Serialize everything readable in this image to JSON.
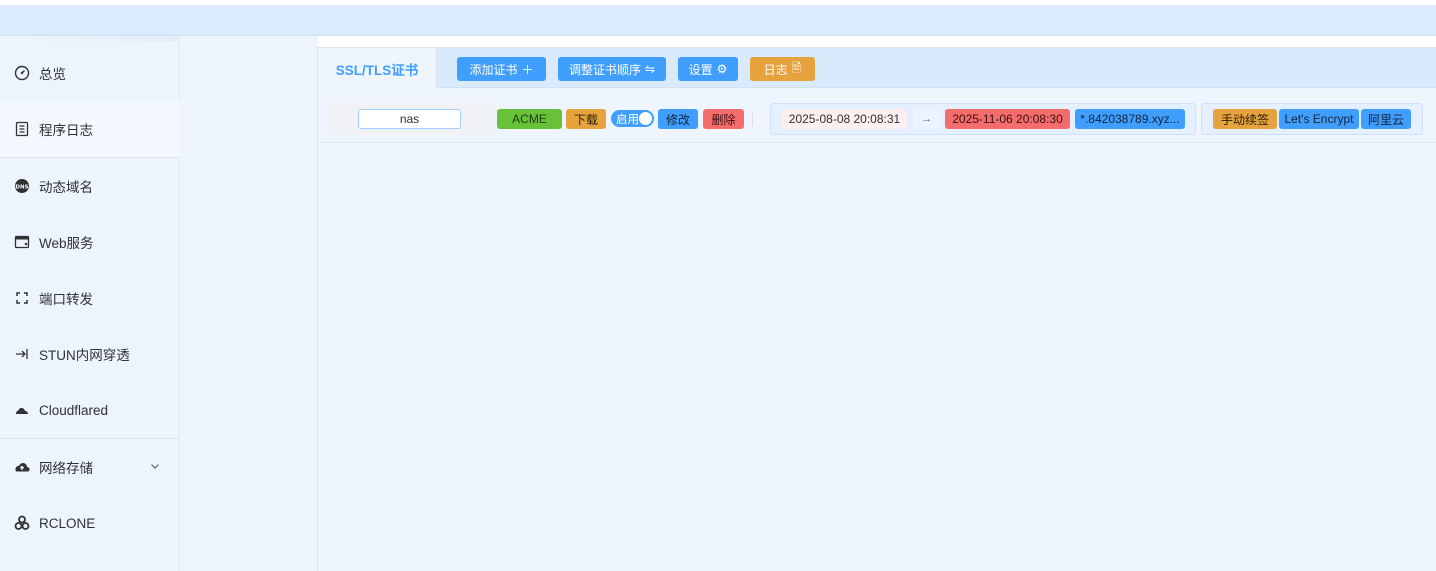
{
  "sidebar": {
    "items": [
      {
        "label": "总览",
        "icon": "dashboard-icon"
      },
      {
        "label": "程序日志",
        "icon": "log-icon"
      },
      {
        "label": "动态域名",
        "icon": "dns-icon"
      },
      {
        "label": "Web服务",
        "icon": "web-icon"
      },
      {
        "label": "端口转发",
        "icon": "port-forward-icon"
      },
      {
        "label": "STUN内网穿透",
        "icon": "stun-icon"
      },
      {
        "label": "Cloudflared",
        "icon": "cloud-icon"
      },
      {
        "label": "网络存储",
        "icon": "cloud-upload-icon"
      },
      {
        "label": "RCLONE",
        "icon": "rclone-icon"
      }
    ]
  },
  "tabs": {
    "active_label": "SSL/TLS证书"
  },
  "toolbar": {
    "add_label": "添加证书",
    "add_suffix": "＋",
    "reorder_label": "调整证书顺序",
    "reorder_suffix": "⇋",
    "settings_label": "设置",
    "settings_suffix": "⚙",
    "log_label": "日志",
    "log_suffix": "🗎"
  },
  "cert_row": {
    "name": "nas",
    "type_tag": "ACME",
    "download_label": "下载",
    "enable_label": "启用",
    "edit_label": "修改",
    "delete_label": "删除",
    "issued_at": "2025-08-08 20:08:31",
    "arrow": "→",
    "expires_at": "2025-11-06 20:08:30",
    "domain": "*.842038789.xyz...",
    "renew_label": "手动续签",
    "ca_label": "Let's Encrypt",
    "dns_provider": "阿里云"
  },
  "colors": {
    "primary": "#409eff",
    "success": "#67c23a",
    "warning": "#e6a23c",
    "danger": "#f56c6c"
  }
}
